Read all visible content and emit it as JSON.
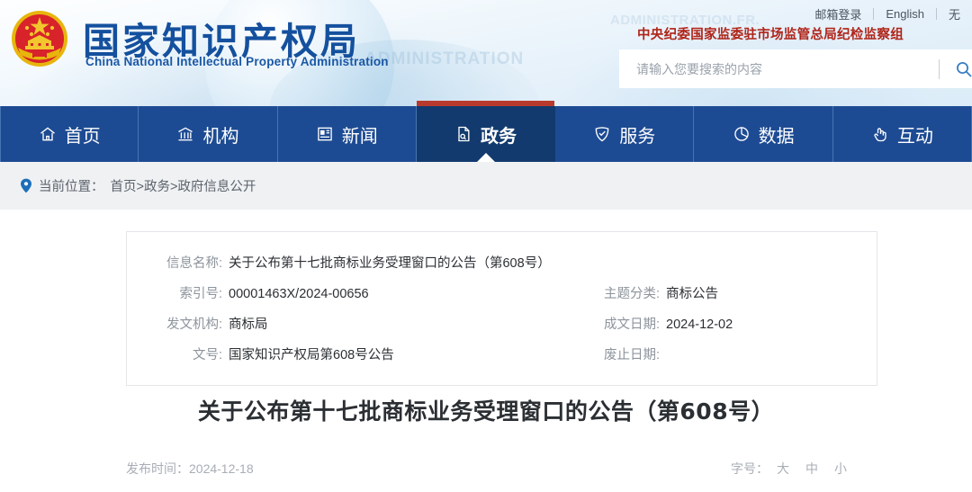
{
  "site": {
    "name_cn": "国家知识产权局",
    "name_en": "China National Intellectual Property Administration",
    "watermark": "ADMINISTRATION",
    "watermark2": "ADMINISTRATION.FR.",
    "emblem_alt": "national-emblem"
  },
  "topbar": {
    "links": [
      "邮箱登录",
      "English"
    ],
    "truncated_link": "无",
    "red_notice": "中央纪委国家监委驻市场监管总局纪检监察组"
  },
  "search": {
    "placeholder": "请输入您要搜索的内容",
    "value": "",
    "icon": "search-icon"
  },
  "nav": {
    "items": [
      {
        "label": "首页",
        "icon": "home-icon",
        "active": false
      },
      {
        "label": "机构",
        "icon": "bank-icon",
        "active": false
      },
      {
        "label": "新闻",
        "icon": "newspaper-icon",
        "active": false
      },
      {
        "label": "政务",
        "icon": "document-icon",
        "active": true
      },
      {
        "label": "服务",
        "icon": "shield-check-icon",
        "active": false
      },
      {
        "label": "数据",
        "icon": "pie-chart-icon",
        "active": false
      },
      {
        "label": "互动",
        "icon": "hand-click-icon",
        "active": false
      }
    ],
    "active_index": 3
  },
  "breadcrumb": {
    "icon": "location-pin-icon",
    "label": "当前位置：",
    "path": "首页>政务>政府信息公开"
  },
  "info": {
    "rows": [
      {
        "label": "信息名称:",
        "value": "关于公布第十七批商标业务受理窗口的公告（第608号）"
      },
      {
        "label": "索引号:",
        "value": "00001463X/2024-00656"
      },
      {
        "label": "发文机构:",
        "value": "商标局"
      },
      {
        "label": "文号:",
        "value": "国家知识产权局第608号公告"
      }
    ],
    "rows_right": [
      {
        "label": "主题分类:",
        "value": "商标公告"
      },
      {
        "label": "成文日期:",
        "value": "2024-12-02"
      },
      {
        "label": "废止日期:",
        "value": ""
      }
    ]
  },
  "article": {
    "title": "关于公布第十七批商标业务受理窗口的公告（第608号）",
    "publish_label": "发布时间：",
    "publish_date": "2024-12-18",
    "fontsize_label": "字号：",
    "fontsize_options": [
      "大",
      "中",
      "小"
    ]
  },
  "colors": {
    "nav_bg": "#1d4b93",
    "nav_active_bg": "#123a6e",
    "accent_red": "#b83a2e",
    "logo_blue": "#14509e",
    "notice_red": "#b02418"
  }
}
